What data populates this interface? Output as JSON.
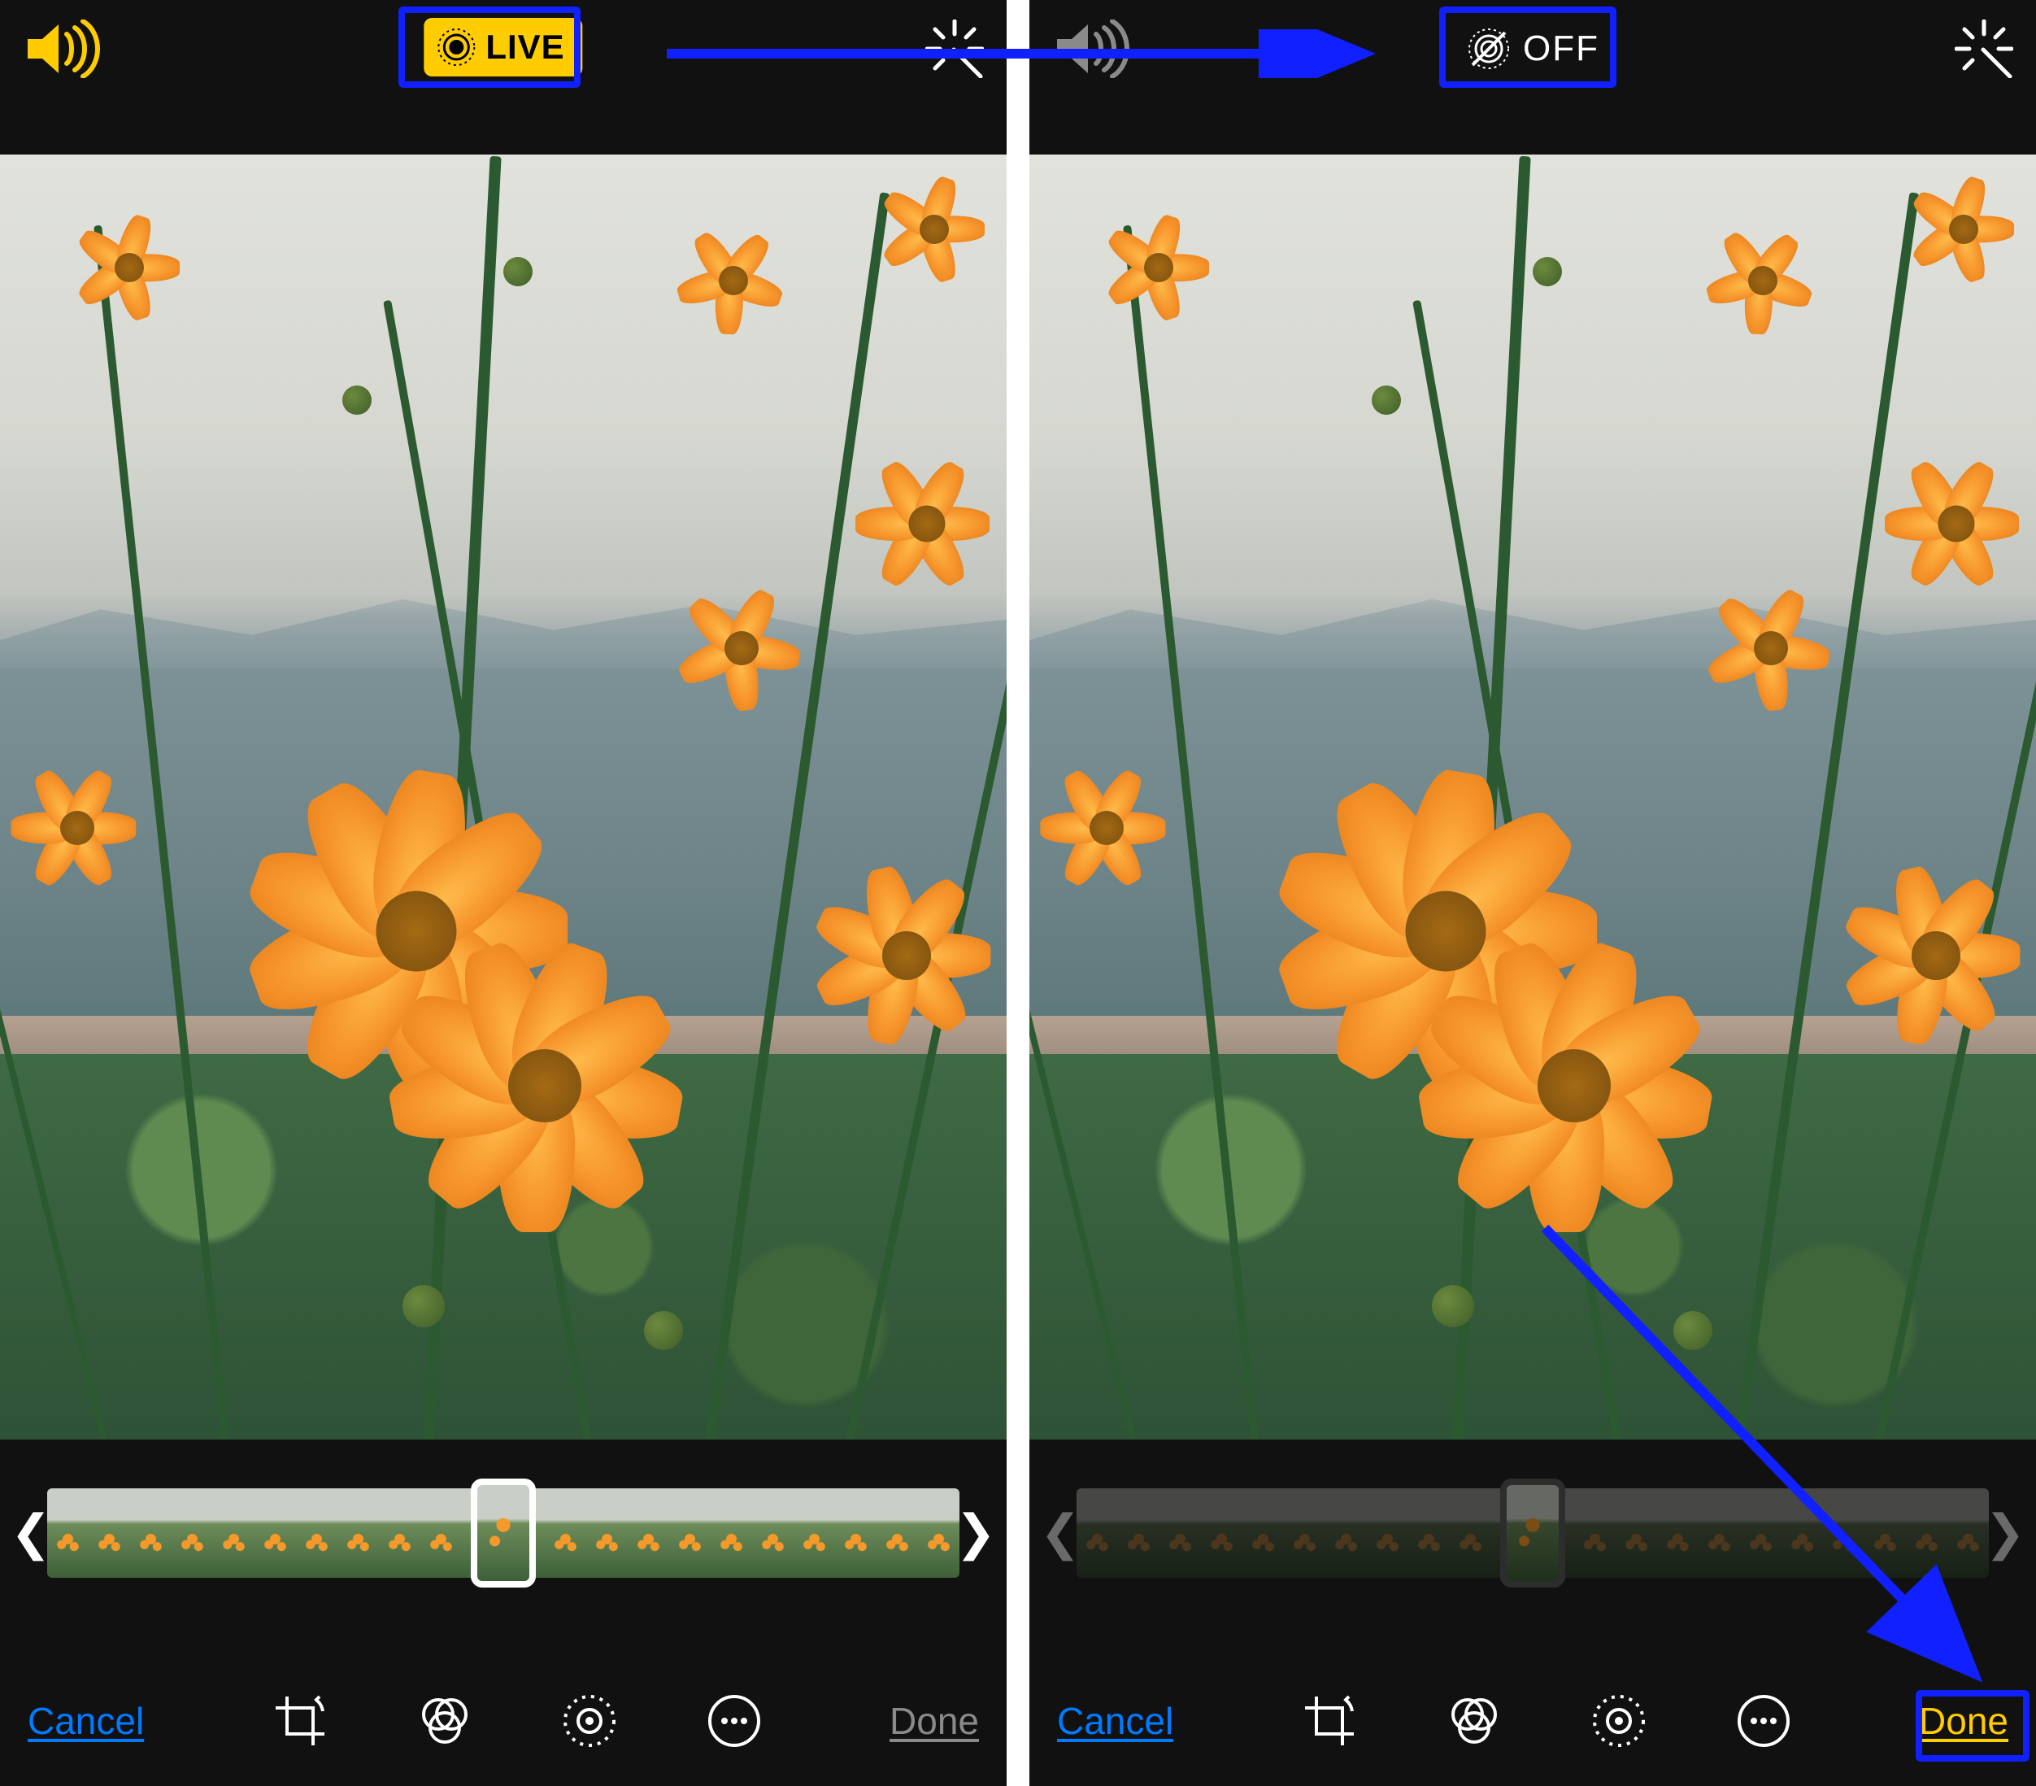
{
  "left": {
    "topbar": {
      "speaker_state": "on",
      "live_badge_label": "LIVE"
    },
    "bottombar": {
      "cancel_label": "Cancel",
      "done_label": "Done",
      "done_active": false
    },
    "filmstrip": {
      "active": true
    }
  },
  "right": {
    "topbar": {
      "speaker_state": "dim",
      "off_badge_label": "OFF"
    },
    "bottombar": {
      "cancel_label": "Cancel",
      "done_label": "Done",
      "done_active": true
    },
    "filmstrip": {
      "active": false
    }
  },
  "toolbar_icons": [
    "crop-rotate-icon",
    "filters-icon",
    "adjust-icon",
    "more-icon"
  ],
  "colors": {
    "accent_yellow": "#FFCC00",
    "accent_blue": "#007AFF",
    "annotation_blue": "#1020FF"
  }
}
